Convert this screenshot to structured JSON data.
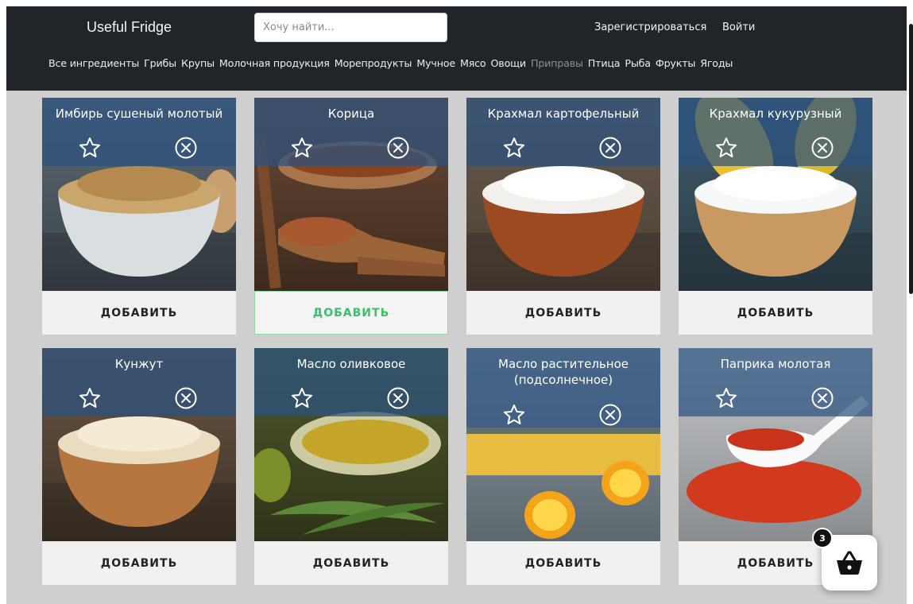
{
  "header": {
    "brand": "Useful Fridge",
    "search_placeholder": "Хочу найти...",
    "register": "Зарегистрироваться",
    "login": "Войти"
  },
  "categories": [
    {
      "label": "Все ингредиенты",
      "active": false
    },
    {
      "label": "Грибы",
      "active": false
    },
    {
      "label": "Крупы",
      "active": false
    },
    {
      "label": "Молочная продукция",
      "active": false
    },
    {
      "label": "Морепродукты",
      "active": false
    },
    {
      "label": "Мучное",
      "active": false
    },
    {
      "label": "Мясо",
      "active": false
    },
    {
      "label": "Овощи",
      "active": false
    },
    {
      "label": "Приправы",
      "active": true
    },
    {
      "label": "Птица",
      "active": false
    },
    {
      "label": "Рыба",
      "active": false
    },
    {
      "label": "Фрукты",
      "active": false
    },
    {
      "label": "Ягоды",
      "active": false
    }
  ],
  "products": [
    {
      "title": "Имбирь сушеный молотый",
      "add_label": "ДОБАВИТЬ",
      "hover": false
    },
    {
      "title": "Корица",
      "add_label": "ДОБАВИТЬ",
      "hover": true
    },
    {
      "title": "Крахмал картофельный",
      "add_label": "ДОБАВИТЬ",
      "hover": false
    },
    {
      "title": "Крахмал кукурузный",
      "add_label": "ДОБАВИТЬ",
      "hover": false
    },
    {
      "title": "Кунжут",
      "add_label": "ДОБАВИТЬ",
      "hover": false
    },
    {
      "title": "Масло оливковое",
      "add_label": "ДОБАВИТЬ",
      "hover": false
    },
    {
      "title": "Масло растительное (подсолнечное)",
      "add_label": "ДОБАВИТЬ",
      "hover": false
    },
    {
      "title": "Паприка молотая",
      "add_label": "ДОБАВИТЬ",
      "hover": false
    }
  ],
  "cart": {
    "count": "3"
  },
  "icons": {
    "favorite": "star-outline-icon",
    "remove": "circle-x-icon",
    "cart": "basket-icon"
  },
  "colors": {
    "header_bg": "#212529",
    "overlay": "#2b5280",
    "hover_green": "#3bbf6a"
  }
}
